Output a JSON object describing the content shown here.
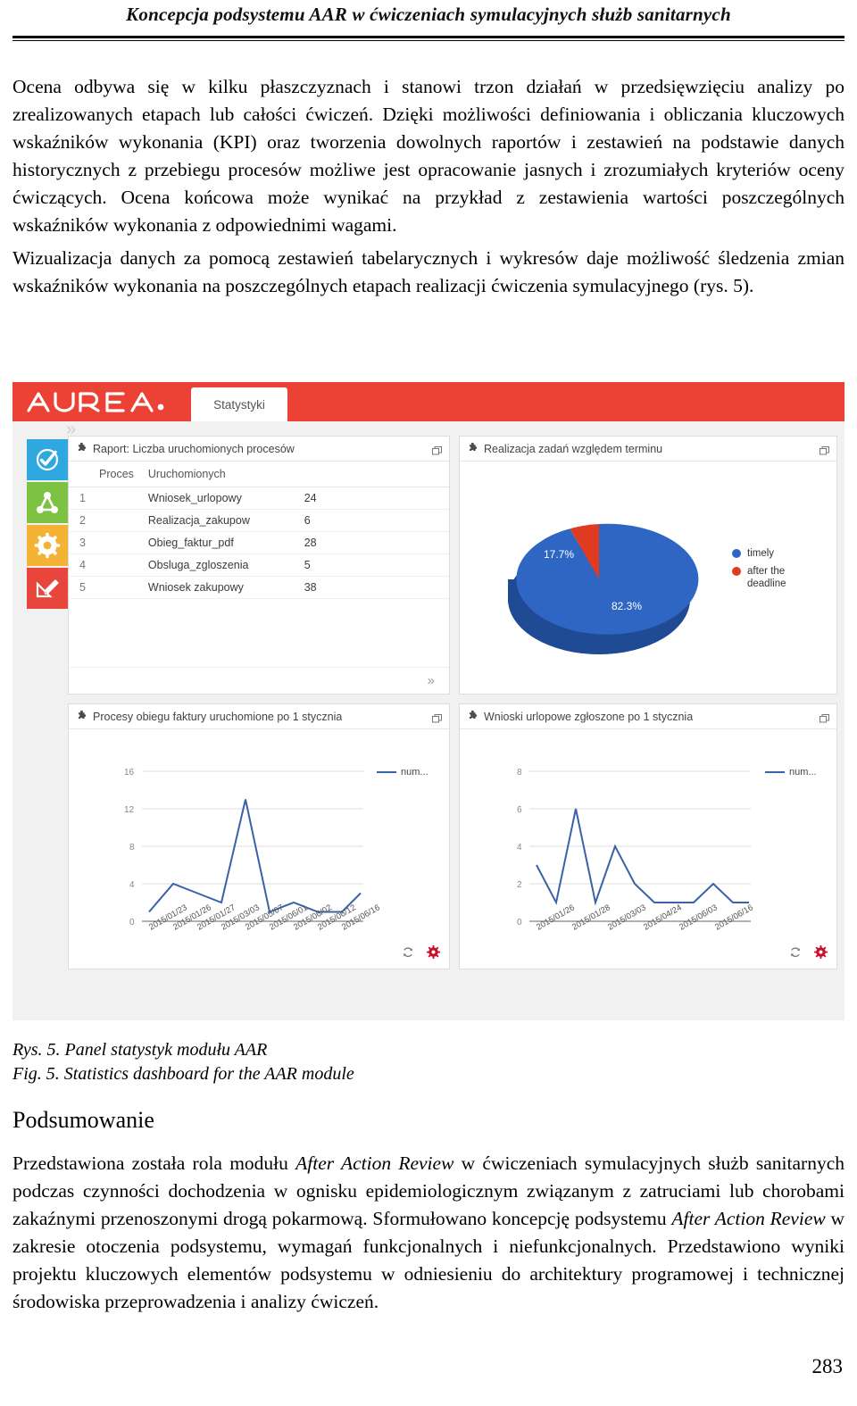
{
  "running_head": "Koncepcja podsystemu AAR w ćwiczeniach symulacyjnych służb sanitarnych",
  "body": {
    "para1": "Ocena odbywa się w kilku płaszczyznach i stanowi trzon działań w przedsięwzięciu analizy po zrealizowanych etapach lub całości ćwiczeń. Dzięki możliwości definiowania i obliczania kluczowych wskaźników wykonania (KPI) oraz tworzenia dowolnych raportów i zestawień na podstawie danych historycznych z przebiegu procesów możliwe jest opracowanie jasnych i zrozumiałych kryteriów oceny ćwiczących. Ocena końcowa może wynikać na przykład z zestawienia wartości poszczególnych wskaźników wykonania z odpowiednimi wagami.",
    "para2": "Wizualizacja danych za pomocą zestawień tabelarycznych i wykresów daje możliwość śledzenia zmian wskaźników wykonania na poszczególnych etapach realizacji ćwiczenia symulacyjnego (rys. 5)."
  },
  "figure": {
    "caption_pl": "Rys. 5. Panel statystyk modułu AAR",
    "caption_en": "Fig. 5. Statistics dashboard for the AAR module"
  },
  "dashboard": {
    "brand": "AUREA",
    "tab_label": "Statystyki",
    "colors": {
      "topbar": "#eb4235",
      "blue": "#3a62a8",
      "pie_blue": "#2f66c4",
      "pie_red": "#e03b20",
      "side_blue": "#2fa8e0",
      "side_green": "#7dc242",
      "side_orange": "#f5b335",
      "side_red": "#e8453c",
      "gear_red": "#c8102e"
    },
    "sidebar": {
      "toggle_icon": "chevron-double-right-icon",
      "items": [
        {
          "name": "tasks-check-icon"
        },
        {
          "name": "process-nodes-icon"
        },
        {
          "name": "settings-gear-icon"
        },
        {
          "name": "design-editor-icon"
        }
      ]
    },
    "panels": {
      "report_table": {
        "title": "Raport: Liczba uruchomionych procesów",
        "columns": [
          "Proces",
          "Uruchomionych"
        ],
        "rows": [
          {
            "idx": "1",
            "proces": "Wniosek_urlopowy",
            "uruchomionych": "24"
          },
          {
            "idx": "2",
            "proces": "Realizacja_zakupow",
            "uruchomionych": "6"
          },
          {
            "idx": "3",
            "proces": "Obieg_faktur_pdf",
            "uruchomionych": "28"
          },
          {
            "idx": "4",
            "proces": "Obsluga_zgloszenia",
            "uruchomionych": "5"
          },
          {
            "idx": "5",
            "proces": "Wniosek zakupowy",
            "uruchomionych": "38"
          }
        ],
        "expand_label": "»"
      },
      "pie_panel": {
        "title": "Realizacja zadań względem terminu"
      },
      "line_invoices": {
        "title": "Procesy obiegu faktury uruchomione po 1 stycznia",
        "legend": "num..."
      },
      "line_leaves": {
        "title": "Wnioski urlopowe zgłoszone po 1 stycznia",
        "legend": "num..."
      }
    }
  },
  "chart_data": [
    {
      "type": "pie",
      "title": "Realizacja zadań względem terminu",
      "labels": [
        "timely",
        "after the deadline"
      ],
      "values": [
        82.3,
        17.7
      ],
      "value_labels": [
        "82.3%",
        "17.7%"
      ],
      "colors": [
        "#2f66c4",
        "#e03b20"
      ],
      "legend": "right",
      "three_d": true
    },
    {
      "type": "line",
      "title": "Procesy obiegu faktury uruchomione po 1 stycznia",
      "series": [
        {
          "name": "num...",
          "values": [
            1,
            4,
            3,
            2,
            13,
            1,
            2,
            1,
            1,
            3
          ]
        }
      ],
      "categories": [
        "2015/01/23",
        "2015/01/26",
        "2015/01/27",
        "2015/03/03",
        "2015/05/07",
        "2015/06/01",
        "2015/06/02",
        "2015/06/12",
        "2015/06/16"
      ],
      "ylim": [
        0,
        16
      ],
      "yticks": [
        0,
        4,
        8,
        12,
        16
      ],
      "xlabel": "",
      "ylabel": "",
      "grid": true,
      "legend": "right"
    },
    {
      "type": "line",
      "title": "Wnioski urlopowe zgłoszone po 1 stycznia",
      "series": [
        {
          "name": "num...",
          "values": [
            3,
            1,
            6,
            1,
            4,
            2,
            1,
            1,
            1,
            2,
            1,
            1
          ]
        }
      ],
      "categories": [
        "2015/01/26",
        "2015/01/28",
        "2015/03/03",
        "2015/04/24",
        "2015/06/03",
        "2015/06/16"
      ],
      "ylim": [
        0,
        8
      ],
      "yticks": [
        0,
        2,
        4,
        6,
        8
      ],
      "xlabel": "",
      "ylabel": "",
      "grid": true,
      "legend": "right"
    }
  ],
  "summary": {
    "heading": "Podsumowanie",
    "text_part1": "Przedstawiona została rola modułu ",
    "term1": "After Action Review",
    "text_part2": " w ćwiczeniach symulacyjnych służb sanitarnych podczas czynności dochodzenia w ognisku epidemiologicznym związanym z zatruciami lub chorobami zakaźnymi przenoszonymi drogą pokarmową. Sformułowano koncepcję podsystemu ",
    "term2": "After Action Review",
    "text_part3": " w zakresie otoczenia podsystemu, wymagań funkcjonalnych i niefunkcjonalnych. Przedstawiono wyniki projektu kluczowych elementów podsystemu w odniesieniu do architektury programowej i technicznej środowiska przeprowadzenia i analizy ćwiczeń."
  },
  "page_number": "283"
}
